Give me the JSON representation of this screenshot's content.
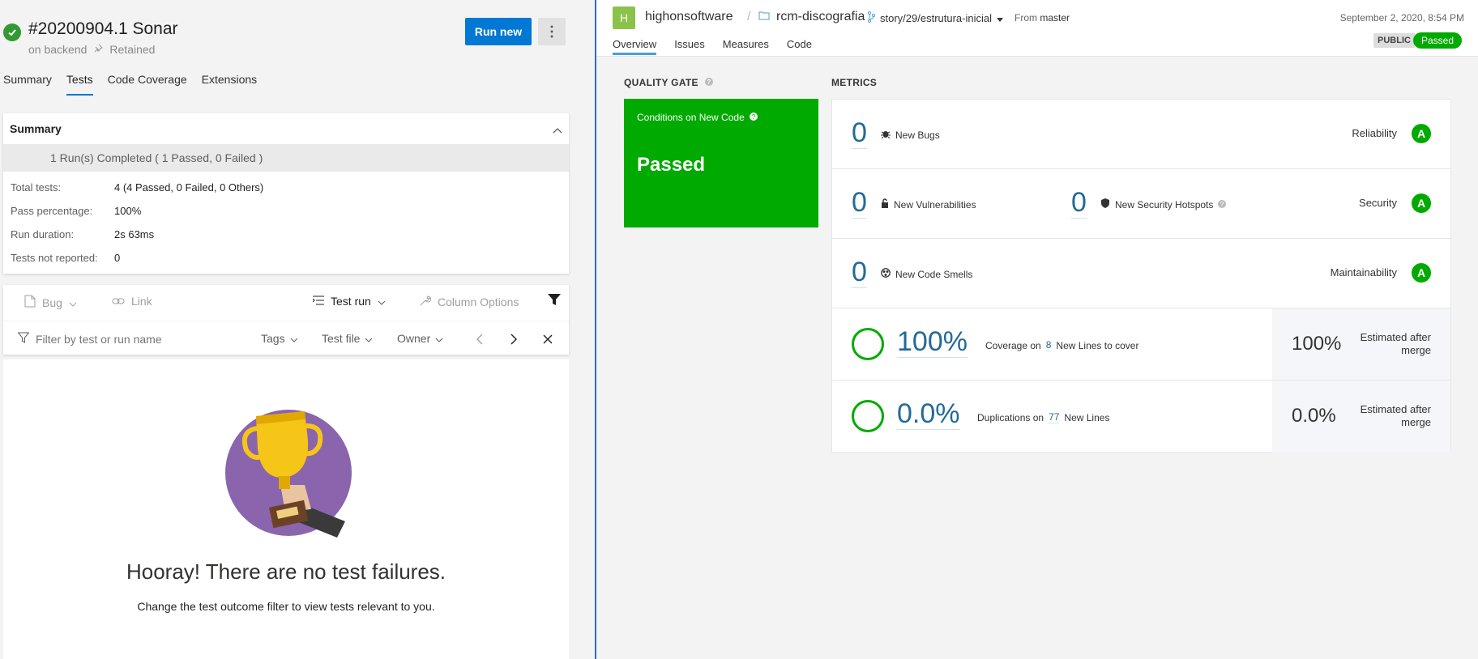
{
  "left": {
    "build_title": "#20200904.1 Sonar",
    "branch": "on backend",
    "retained": "Retained",
    "run_new": "Run new",
    "tabs": [
      "Summary",
      "Tests",
      "Code Coverage",
      "Extensions"
    ],
    "active_tab": "Tests",
    "summary": {
      "heading": "Summary",
      "runs_completed": "1 Run(s) Completed ( 1 Passed, 0 Failed )",
      "stats": [
        {
          "label": "Total tests:",
          "value": "4 (4 Passed, 0 Failed, 0 Others)"
        },
        {
          "label": "Pass percentage:",
          "value": "100%"
        },
        {
          "label": "Run duration:",
          "value": "2s 63ms"
        },
        {
          "label": "Tests not reported:",
          "value": "0"
        }
      ]
    },
    "toolbar": {
      "bug": "Bug",
      "link": "Link",
      "test_run": "Test run",
      "column_options": "Column Options"
    },
    "filter": {
      "placeholder": "Filter by test or run name",
      "tags": "Tags",
      "test_file": "Test file",
      "owner": "Owner"
    },
    "empty": {
      "title": "Hooray! There are no test failures.",
      "subtitle": "Change the test outcome filter to view tests relevant to you."
    }
  },
  "sonar": {
    "org_initial": "H",
    "org": "highonsoftware",
    "project": "rcm-discografia",
    "branch": "story/29/estrutura-inicial",
    "from_label": "From",
    "from_branch": "master",
    "date": "September 2, 2020, 8:54 PM",
    "badge_public": "PUBLIC",
    "badge_passed": "Passed",
    "tabs": [
      "Overview",
      "Issues",
      "Measures",
      "Code"
    ],
    "active_tab": "Overview",
    "quality_gate": {
      "title": "QUALITY GATE",
      "conditions": "Conditions on New Code",
      "status": "Passed"
    },
    "metrics_title": "METRICS",
    "reliability": {
      "value": "0",
      "label": "New Bugs",
      "rating_label": "Reliability",
      "rating": "A"
    },
    "security": {
      "value": "0",
      "label": "New Vulnerabilities",
      "hotspots_value": "0",
      "hotspots_label": "New Security Hotspots",
      "rating_label": "Security",
      "rating": "A"
    },
    "maintainability": {
      "value": "0",
      "label": "New Code Smells",
      "rating_label": "Maintainability",
      "rating": "A"
    },
    "coverage": {
      "value": "100%",
      "prefix": "Coverage on",
      "lines": "8",
      "suffix": "New Lines to cover",
      "estimated": "100%",
      "estimated_label": "Estimated after merge"
    },
    "duplications": {
      "value": "0.0%",
      "prefix": "Duplications on",
      "lines": "77",
      "suffix": "New Lines",
      "estimated": "0.0%",
      "estimated_label": "Estimated after merge"
    }
  }
}
